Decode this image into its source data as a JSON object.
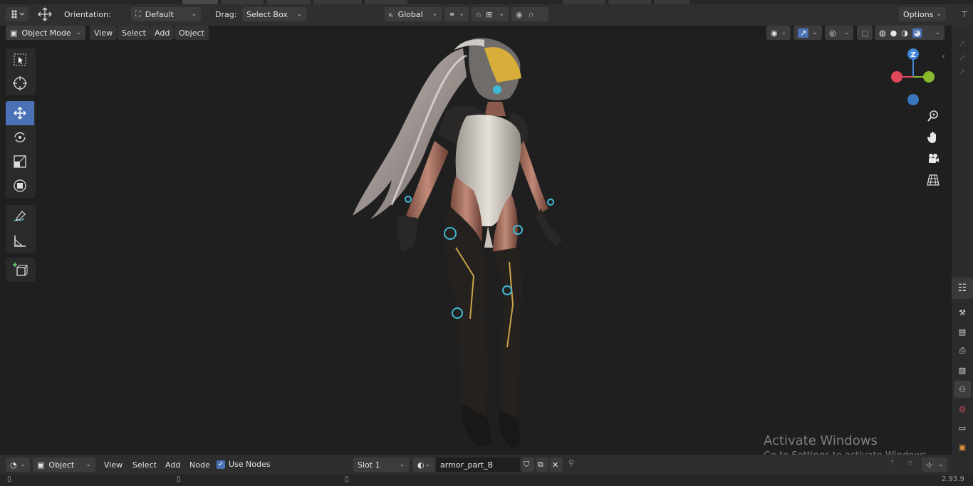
{
  "header": {
    "orientation_label": "Orientation:",
    "orientation_value": "Default",
    "drag_label": "Drag:",
    "drag_value": "Select Box",
    "transform_space": "Global",
    "options_label": "Options"
  },
  "viewport_menu": {
    "mode": "Object Mode",
    "items": [
      "View",
      "Select",
      "Add",
      "Object"
    ]
  },
  "gizmo": {
    "z_label": "Z"
  },
  "watermark": {
    "title": "Activate Windows",
    "subtitle": "Go to Settings to activate Windows."
  },
  "shader_editor": {
    "type": "Object",
    "menu_items": [
      "View",
      "Select",
      "Add",
      "Node"
    ],
    "use_nodes_label": "Use Nodes",
    "use_nodes_checked": true,
    "slot": "Slot 1",
    "material": "armor_part_B"
  },
  "status": {
    "version": "2.93.9"
  },
  "colors": {
    "accent_active": "#4b72b6",
    "axis_x": "#e0475a",
    "axis_y": "#8ab92d",
    "axis_z": "#3f86d8"
  }
}
